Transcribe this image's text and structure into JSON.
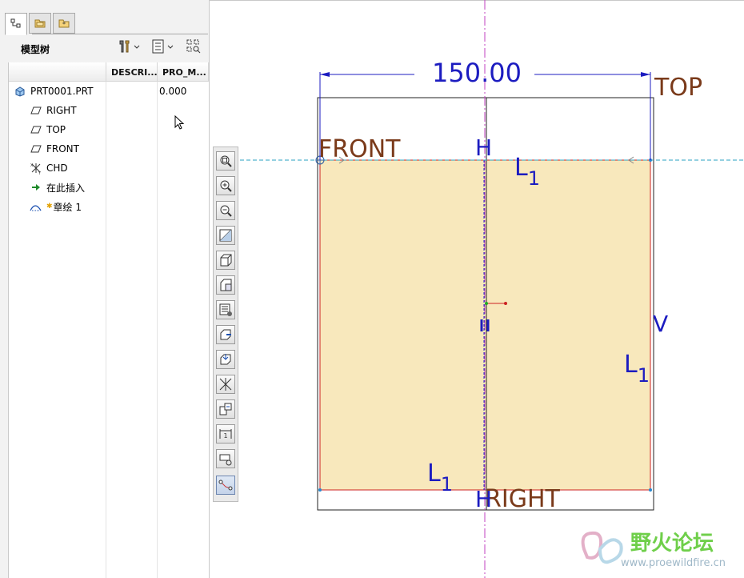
{
  "model_tree": {
    "tabs": [
      {
        "icon": "model-tree-icon"
      },
      {
        "icon": "folder-browser-icon"
      },
      {
        "icon": "favorites-icon"
      }
    ],
    "title": "模型树",
    "toolbar": {
      "settings_icon": "tools-icon",
      "show_icon": "list-icon",
      "filter_icon": "tree-filter-icon"
    },
    "columns": [
      "DESCRI...",
      "PRO_M..."
    ],
    "items": [
      {
        "label": "PRT0001.PRT",
        "icon": "part-icon",
        "value": "0.000"
      },
      {
        "label": "RIGHT",
        "icon": "datum-plane-icon"
      },
      {
        "label": "TOP",
        "icon": "datum-plane-icon"
      },
      {
        "label": "FRONT",
        "icon": "datum-plane-icon"
      },
      {
        "label": "CHD",
        "icon": "coordinate-system-icon"
      },
      {
        "label": "在此插入",
        "icon": "insert-here-arrow-icon"
      },
      {
        "label": "章绘 1",
        "icon": "sketch-icon"
      }
    ]
  },
  "view_toolbar": {
    "buttons": [
      "refit-icon",
      "zoom-in-icon",
      "zoom-out-icon",
      "repaint-icon",
      "shading-icon",
      "saved-views-icon",
      "layers-icon",
      "orient-icon",
      "sketch-view-icon",
      "datum-display-icon",
      "constraint-display-icon",
      "dimension-display-icon",
      "grid-display-icon",
      "vertex-display-icon"
    ],
    "active": "vertex-display-icon"
  },
  "sketch": {
    "dimension": "150.00",
    "datum_labels": {
      "top": "TOP",
      "front": "FRONT",
      "right": "RIGHT"
    },
    "constraints": {
      "h_top": "H",
      "h_bottom": "H",
      "v_right": "V",
      "l1": "L1",
      "eq": "II"
    },
    "fill_color": "#f8e8bc",
    "line_color": "#cc2222"
  },
  "watermark": {
    "title": "野火论坛",
    "url": "www.proewildfire.cn"
  }
}
